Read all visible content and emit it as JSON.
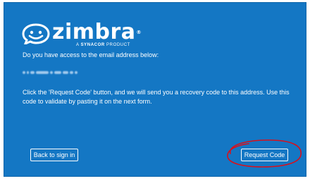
{
  "logo": {
    "icon": "zimbra-smile-logo-icon",
    "word": "zimbra",
    "trademark": "®",
    "sub_prefix": "A",
    "sub_brand": "SYNACOR",
    "sub_suffix": "PRODUCT"
  },
  "recovery": {
    "question": "Do you have access to the email address below:",
    "instructions": "Click the 'Request Code' button, and we will send you a recovery code to this address. Use this code to validate by pasting it on the next form."
  },
  "buttons": {
    "back_label": "Back to sign in",
    "request_label": "Request Code"
  },
  "colors": {
    "panel_background": "#1477c4",
    "text": "#ffffff",
    "highlight_ring": "#d8101c"
  }
}
